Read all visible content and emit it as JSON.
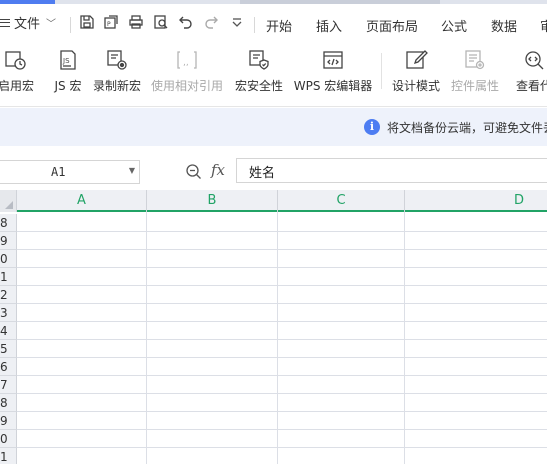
{
  "menu": {
    "file_label": "文件",
    "tabs": [
      "开始",
      "插入",
      "页面布局",
      "公式",
      "数据",
      "审"
    ]
  },
  "ribbon": {
    "buttons": [
      {
        "label": "启用宏",
        "icon": "enable-macro-icon",
        "disabled": false
      },
      {
        "label": "JS 宏",
        "icon": "js-macro-icon",
        "disabled": false
      },
      {
        "label": "录制新宏",
        "icon": "record-macro-icon",
        "disabled": false
      },
      {
        "label": "使用相对引用",
        "icon": "relative-reference-icon",
        "disabled": true
      },
      {
        "label": "宏安全性",
        "icon": "macro-security-icon",
        "disabled": false
      },
      {
        "label": "WPS 宏编辑器",
        "icon": "macro-editor-icon",
        "disabled": false
      },
      {
        "label": "设计模式",
        "icon": "design-mode-icon",
        "disabled": false
      },
      {
        "label": "控件属性",
        "icon": "control-properties-icon",
        "disabled": true
      },
      {
        "label": "查看代",
        "icon": "view-code-icon",
        "disabled": false
      }
    ]
  },
  "notice": {
    "message": "将文档备份云端，可避免文件丢"
  },
  "formula_bar": {
    "cell_ref": "A1",
    "fx_label": "fx",
    "value": "姓名"
  },
  "sheet": {
    "columns": [
      "A",
      "B",
      "C",
      "D"
    ],
    "rows": [
      "8",
      "9",
      "0",
      "1",
      "2",
      "3",
      "4",
      "5",
      "6",
      "7",
      "8",
      "9",
      "0",
      "1"
    ]
  },
  "colors": {
    "accent": "#4f7cf0",
    "selection_green": "#21a366",
    "info_blue": "#4d7df2"
  }
}
